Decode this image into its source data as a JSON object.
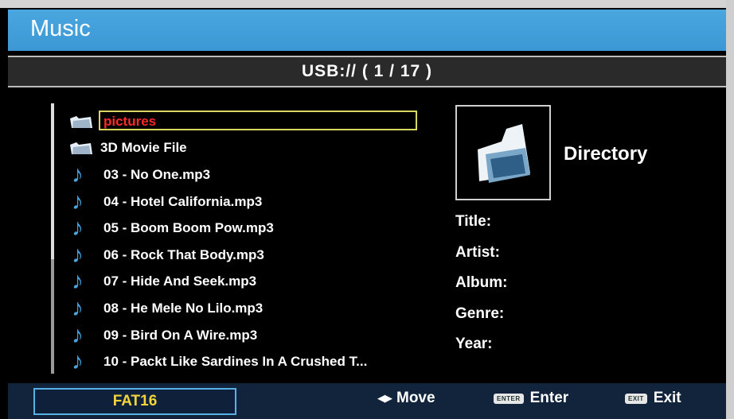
{
  "header": {
    "title": "Music"
  },
  "path_bar": {
    "text": "USB:// ( 1 / 17 )"
  },
  "file_list": [
    {
      "name": "pictures",
      "icon": "folder-icon",
      "selected": true
    },
    {
      "name": "3D Movie File",
      "icon": "folder-icon"
    },
    {
      "name": "03 - No One.mp3",
      "icon": "music-note-icon"
    },
    {
      "name": "04 - Hotel California.mp3",
      "icon": "music-note-icon"
    },
    {
      "name": "05 - Boom Boom Pow.mp3",
      "icon": "music-note-icon"
    },
    {
      "name": "06 - Rock That Body.mp3",
      "icon": "music-note-icon"
    },
    {
      "name": "07 - Hide And Seek.mp3",
      "icon": "music-note-icon"
    },
    {
      "name": "08 - He Mele No Lilo.mp3",
      "icon": "music-note-icon"
    },
    {
      "name": "09 - Bird On A Wire.mp3",
      "icon": "music-note-icon"
    },
    {
      "name": "10 - Packt Like Sardines In A Crushed T...",
      "icon": "music-note-icon"
    }
  ],
  "info_panel": {
    "type_label": "Directory",
    "fields": {
      "title": "Title:",
      "artist": "Artist:",
      "album": "Album:",
      "genre": "Genre:",
      "year": "Year:"
    }
  },
  "footer": {
    "filesystem": "FAT16",
    "move": {
      "label": "Move"
    },
    "enter": {
      "key": "ENTER",
      "label": "Enter"
    },
    "exit": {
      "key": "EXIT",
      "label": "Exit"
    }
  },
  "colors": {
    "title_bar": "#3c98d4",
    "selected_text": "#ff2a2a",
    "highlight_border": "#d8d860",
    "note_icon": "#45a6e3",
    "filesystem_text": "#f1d53b",
    "footer_bg": "#12243c"
  }
}
